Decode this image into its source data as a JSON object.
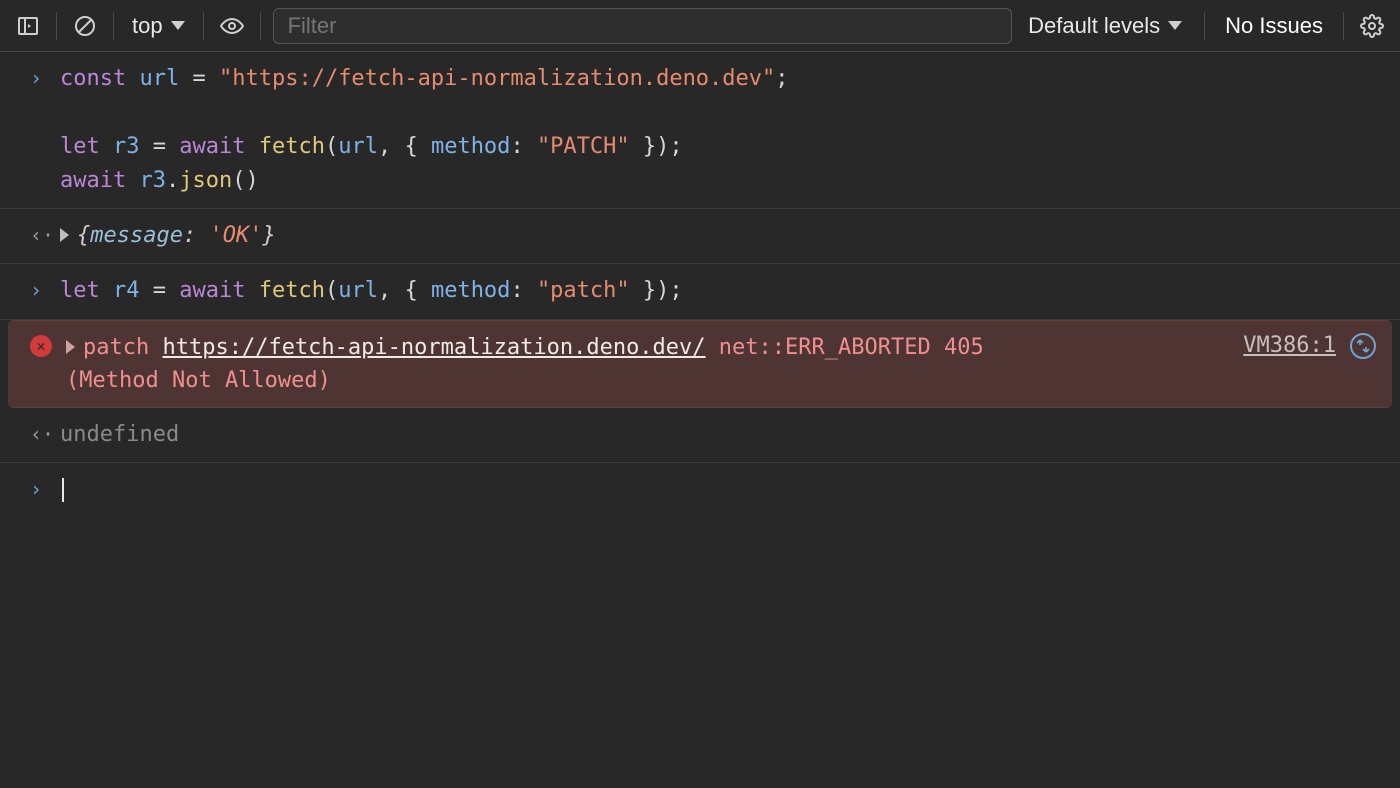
{
  "toolbar": {
    "context_label": "top",
    "filter_placeholder": "Filter",
    "levels_label": "Default levels",
    "issues_label": "No Issues"
  },
  "console": {
    "blocks": [
      {
        "type": "input",
        "lines": [
          [
            {
              "t": "const",
              "c": "kw"
            },
            {
              "t": " ",
              "c": "op"
            },
            {
              "t": "url",
              "c": "var"
            },
            {
              "t": " = ",
              "c": "op"
            },
            {
              "t": "\"https://fetch-api-normalization.deno.dev\"",
              "c": "str"
            },
            {
              "t": ";",
              "c": "op"
            }
          ],
          [
            {
              "t": "",
              "c": "op"
            }
          ],
          [
            {
              "t": "let",
              "c": "kw"
            },
            {
              "t": " ",
              "c": "op"
            },
            {
              "t": "r3",
              "c": "var"
            },
            {
              "t": " = ",
              "c": "op"
            },
            {
              "t": "await",
              "c": "kw"
            },
            {
              "t": " ",
              "c": "op"
            },
            {
              "t": "fetch",
              "c": "fn"
            },
            {
              "t": "(",
              "c": "op"
            },
            {
              "t": "url",
              "c": "var"
            },
            {
              "t": ", { ",
              "c": "op"
            },
            {
              "t": "method",
              "c": "var"
            },
            {
              "t": ": ",
              "c": "op"
            },
            {
              "t": "\"PATCH\"",
              "c": "str"
            },
            {
              "t": " });",
              "c": "op"
            }
          ],
          [
            {
              "t": "await",
              "c": "kw"
            },
            {
              "t": " ",
              "c": "op"
            },
            {
              "t": "r3",
              "c": "var"
            },
            {
              "t": ".",
              "c": "op"
            },
            {
              "t": "json",
              "c": "fn"
            },
            {
              "t": "()",
              "c": "op"
            }
          ]
        ]
      },
      {
        "type": "output_obj",
        "key": "message",
        "value": "'OK'"
      },
      {
        "type": "input",
        "lines": [
          [
            {
              "t": "let",
              "c": "kw"
            },
            {
              "t": " ",
              "c": "op"
            },
            {
              "t": "r4",
              "c": "var"
            },
            {
              "t": " = ",
              "c": "op"
            },
            {
              "t": "await",
              "c": "kw"
            },
            {
              "t": " ",
              "c": "op"
            },
            {
              "t": "fetch",
              "c": "fn"
            },
            {
              "t": "(",
              "c": "op"
            },
            {
              "t": "url",
              "c": "var"
            },
            {
              "t": ", { ",
              "c": "op"
            },
            {
              "t": "method",
              "c": "var"
            },
            {
              "t": ": ",
              "c": "op"
            },
            {
              "t": "\"patch\"",
              "c": "str"
            },
            {
              "t": " });",
              "c": "op"
            }
          ]
        ]
      },
      {
        "type": "error",
        "method": "patch",
        "url": "https://fetch-api-normalization.deno.dev/",
        "net": "net::ERR_ABORTED 405",
        "reason": "(Method Not Allowed)",
        "source": "VM386:1"
      },
      {
        "type": "output_undef",
        "text": "undefined"
      },
      {
        "type": "prompt"
      }
    ]
  }
}
